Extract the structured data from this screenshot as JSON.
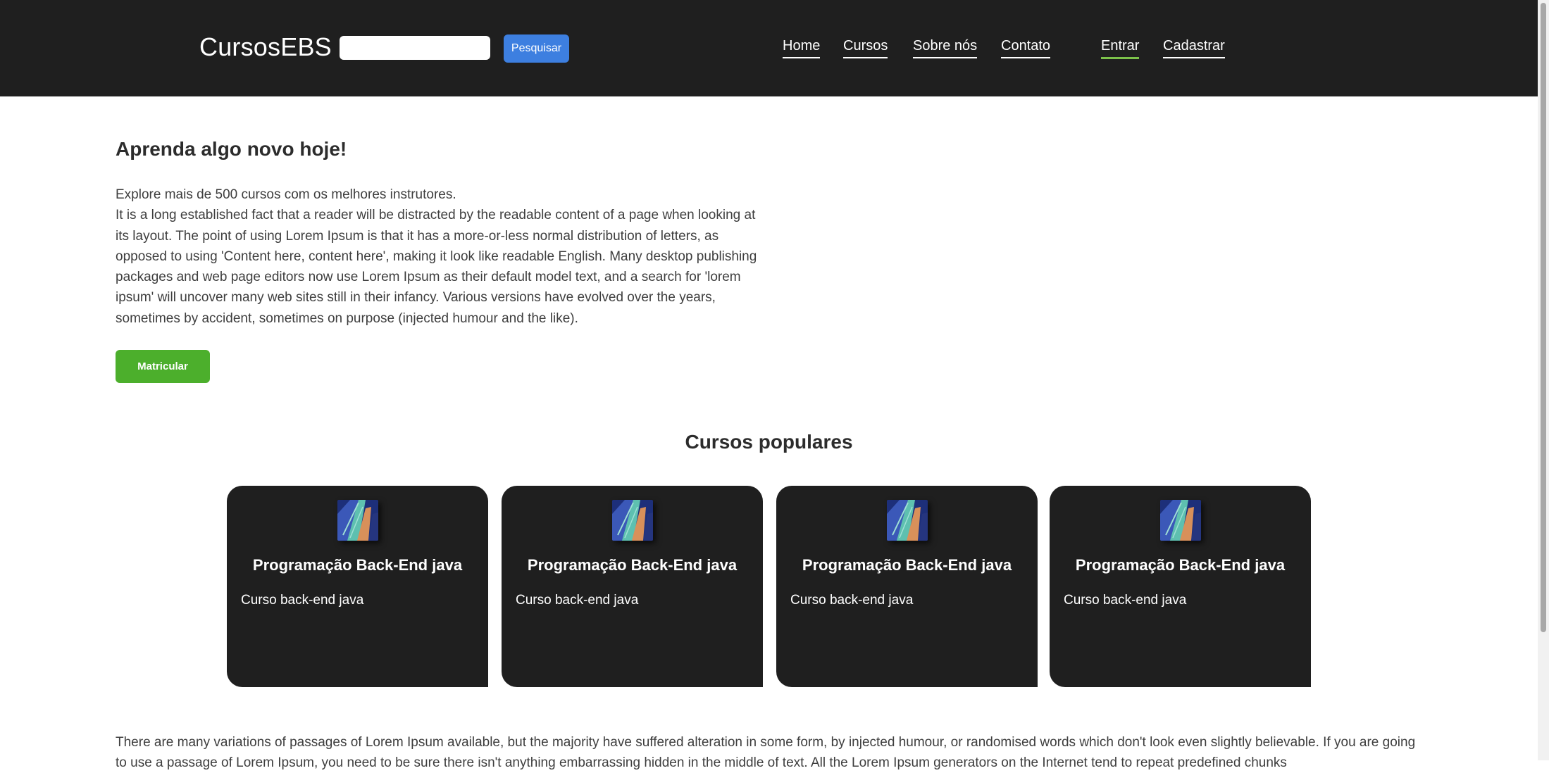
{
  "header": {
    "logo": "CursosEBS",
    "search": {
      "value": "",
      "placeholder": ""
    },
    "search_button": "Pesquisar",
    "nav": [
      "Home",
      "Cursos",
      "Sobre nós",
      "Contato"
    ],
    "auth": [
      "Entrar",
      "Cadastrar"
    ],
    "active_accent": "#7cc14a"
  },
  "hero": {
    "title": "Aprenda algo novo hoje!",
    "lead": "Explore mais de 500 cursos com os melhores instrutores.",
    "body": "It is a long established fact that a reader will be distracted by the readable content of a page when looking at its layout. The point of using Lorem Ipsum is that it has a more-or-less normal distribution of letters, as opposed to using 'Content here, content here', making it look like readable English. Many desktop publishing packages and web page editors now use Lorem Ipsum as their default model text, and a search for 'lorem ipsum' will uncover many web sites still in their infancy. Various versions have evolved over the years, sometimes by accident, sometimes on purpose (injected humour and the like).",
    "button": "Matricular"
  },
  "popular": {
    "title": "Cursos populares",
    "cards": [
      {
        "title": "Programação Back-End java",
        "description": "Curso back-end java"
      },
      {
        "title": "Programação Back-End java",
        "description": "Curso back-end java"
      },
      {
        "title": "Programação Back-End java",
        "description": "Curso back-end java"
      },
      {
        "title": "Programação Back-End java",
        "description": "Curso back-end java"
      }
    ]
  },
  "footer_text": "There are many variations of passages of Lorem Ipsum available, but the majority have suffered alteration in some form, by injected humour, or randomised words which don't look even slightly believable. If you are going to use a passage of Lorem Ipsum, you need to be sure there isn't anything embarrassing hidden in the middle of text. All the Lorem Ipsum generators on the Internet tend to repeat predefined chunks",
  "colors": {
    "header_bg": "#1f1f1f",
    "search_button": "#3d7fe0",
    "enroll_button": "#4caf2c",
    "card_bg": "#1f1f1f"
  },
  "icons": {
    "course_thumbnail": "building-thumbnail-icon"
  }
}
